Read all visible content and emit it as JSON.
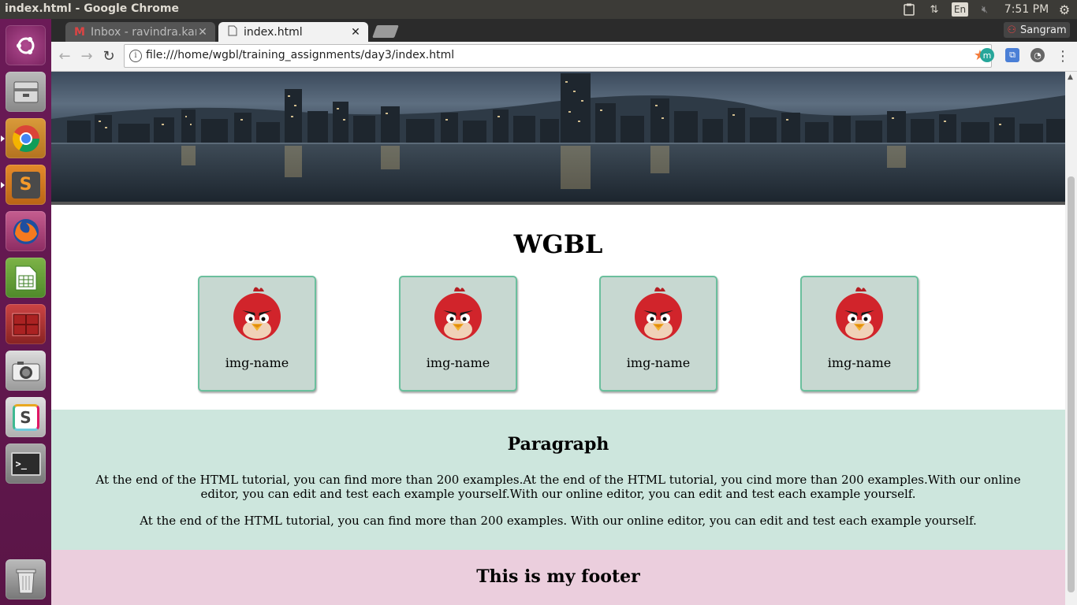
{
  "window": {
    "title": "index.html - Google Chrome"
  },
  "top_panel": {
    "clock": "7:51 PM",
    "lang": "En"
  },
  "launcher": {
    "items": [
      {
        "name": "ubuntu-dash-icon"
      },
      {
        "name": "files-icon"
      },
      {
        "name": "chrome-icon"
      },
      {
        "name": "sublime-text-icon",
        "glyph": "S"
      },
      {
        "name": "firefox-icon"
      },
      {
        "name": "libreoffice-calc-icon"
      },
      {
        "name": "remote-terminal-icon"
      },
      {
        "name": "camera-icon"
      },
      {
        "name": "slack-icon",
        "glyph": "S"
      },
      {
        "name": "terminal-icon",
        "glyph": ">_"
      },
      {
        "name": "trash-icon"
      }
    ]
  },
  "browser": {
    "tabs": [
      {
        "label": "Inbox - ravindra.kar",
        "icon": "gmail-icon",
        "active": false
      },
      {
        "label": "index.html",
        "icon": "page-icon",
        "active": true
      }
    ],
    "profile": "Sangram",
    "url": "file:///home/wgbl/training_assignments/day3/index.html"
  },
  "page": {
    "title": "WGBL",
    "cards": [
      {
        "label": "img-name"
      },
      {
        "label": "img-name"
      },
      {
        "label": "img-name"
      },
      {
        "label": "img-name"
      }
    ],
    "paragraph_section": {
      "heading": "Paragraph",
      "p1": "At the end of the HTML tutorial, you can find more than 200 examples.At the end of the HTML tutorial, you cind more than 200 examples.With our online editor, you can edit and test each example yourself.With our online editor, you can edit and test each example yourself.",
      "p2": "At the end of the HTML tutorial, you can find more than 200 examples. With our online editor, you can edit and test each example yourself."
    },
    "footer": "This is my footer"
  },
  "colors": {
    "card_bg": "#c7d8d1",
    "card_border": "#6bbf9d",
    "paragraph_bg": "#cde6dd",
    "footer_bg": "#ebcedd",
    "bookmark_star": "#f47c3c"
  }
}
